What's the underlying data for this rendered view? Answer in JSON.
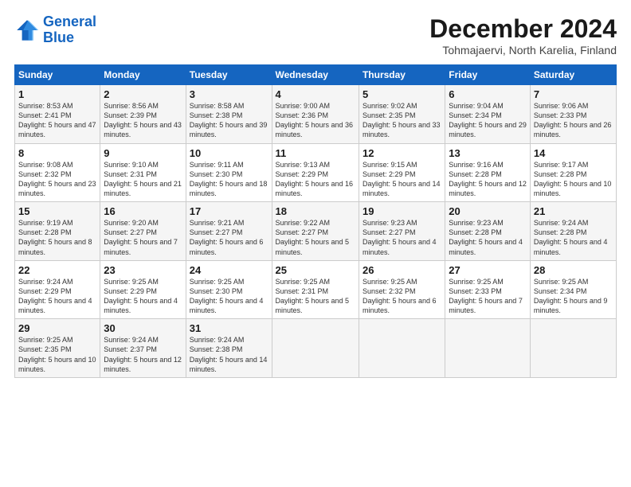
{
  "header": {
    "logo_line1": "General",
    "logo_line2": "Blue",
    "month_title": "December 2024",
    "subtitle": "Tohmajaervi, North Karelia, Finland"
  },
  "columns": [
    "Sunday",
    "Monday",
    "Tuesday",
    "Wednesday",
    "Thursday",
    "Friday",
    "Saturday"
  ],
  "weeks": [
    [
      {
        "day": "1",
        "sunrise": "Sunrise: 8:53 AM",
        "sunset": "Sunset: 2:41 PM",
        "daylight": "Daylight: 5 hours and 47 minutes."
      },
      {
        "day": "2",
        "sunrise": "Sunrise: 8:56 AM",
        "sunset": "Sunset: 2:39 PM",
        "daylight": "Daylight: 5 hours and 43 minutes."
      },
      {
        "day": "3",
        "sunrise": "Sunrise: 8:58 AM",
        "sunset": "Sunset: 2:38 PM",
        "daylight": "Daylight: 5 hours and 39 minutes."
      },
      {
        "day": "4",
        "sunrise": "Sunrise: 9:00 AM",
        "sunset": "Sunset: 2:36 PM",
        "daylight": "Daylight: 5 hours and 36 minutes."
      },
      {
        "day": "5",
        "sunrise": "Sunrise: 9:02 AM",
        "sunset": "Sunset: 2:35 PM",
        "daylight": "Daylight: 5 hours and 33 minutes."
      },
      {
        "day": "6",
        "sunrise": "Sunrise: 9:04 AM",
        "sunset": "Sunset: 2:34 PM",
        "daylight": "Daylight: 5 hours and 29 minutes."
      },
      {
        "day": "7",
        "sunrise": "Sunrise: 9:06 AM",
        "sunset": "Sunset: 2:33 PM",
        "daylight": "Daylight: 5 hours and 26 minutes."
      }
    ],
    [
      {
        "day": "8",
        "sunrise": "Sunrise: 9:08 AM",
        "sunset": "Sunset: 2:32 PM",
        "daylight": "Daylight: 5 hours and 23 minutes."
      },
      {
        "day": "9",
        "sunrise": "Sunrise: 9:10 AM",
        "sunset": "Sunset: 2:31 PM",
        "daylight": "Daylight: 5 hours and 21 minutes."
      },
      {
        "day": "10",
        "sunrise": "Sunrise: 9:11 AM",
        "sunset": "Sunset: 2:30 PM",
        "daylight": "Daylight: 5 hours and 18 minutes."
      },
      {
        "day": "11",
        "sunrise": "Sunrise: 9:13 AM",
        "sunset": "Sunset: 2:29 PM",
        "daylight": "Daylight: 5 hours and 16 minutes."
      },
      {
        "day": "12",
        "sunrise": "Sunrise: 9:15 AM",
        "sunset": "Sunset: 2:29 PM",
        "daylight": "Daylight: 5 hours and 14 minutes."
      },
      {
        "day": "13",
        "sunrise": "Sunrise: 9:16 AM",
        "sunset": "Sunset: 2:28 PM",
        "daylight": "Daylight: 5 hours and 12 minutes."
      },
      {
        "day": "14",
        "sunrise": "Sunrise: 9:17 AM",
        "sunset": "Sunset: 2:28 PM",
        "daylight": "Daylight: 5 hours and 10 minutes."
      }
    ],
    [
      {
        "day": "15",
        "sunrise": "Sunrise: 9:19 AM",
        "sunset": "Sunset: 2:28 PM",
        "daylight": "Daylight: 5 hours and 8 minutes."
      },
      {
        "day": "16",
        "sunrise": "Sunrise: 9:20 AM",
        "sunset": "Sunset: 2:27 PM",
        "daylight": "Daylight: 5 hours and 7 minutes."
      },
      {
        "day": "17",
        "sunrise": "Sunrise: 9:21 AM",
        "sunset": "Sunset: 2:27 PM",
        "daylight": "Daylight: 5 hours and 6 minutes."
      },
      {
        "day": "18",
        "sunrise": "Sunrise: 9:22 AM",
        "sunset": "Sunset: 2:27 PM",
        "daylight": "Daylight: 5 hours and 5 minutes."
      },
      {
        "day": "19",
        "sunrise": "Sunrise: 9:23 AM",
        "sunset": "Sunset: 2:27 PM",
        "daylight": "Daylight: 5 hours and 4 minutes."
      },
      {
        "day": "20",
        "sunrise": "Sunrise: 9:23 AM",
        "sunset": "Sunset: 2:28 PM",
        "daylight": "Daylight: 5 hours and 4 minutes."
      },
      {
        "day": "21",
        "sunrise": "Sunrise: 9:24 AM",
        "sunset": "Sunset: 2:28 PM",
        "daylight": "Daylight: 5 hours and 4 minutes."
      }
    ],
    [
      {
        "day": "22",
        "sunrise": "Sunrise: 9:24 AM",
        "sunset": "Sunset: 2:29 PM",
        "daylight": "Daylight: 5 hours and 4 minutes."
      },
      {
        "day": "23",
        "sunrise": "Sunrise: 9:25 AM",
        "sunset": "Sunset: 2:29 PM",
        "daylight": "Daylight: 5 hours and 4 minutes."
      },
      {
        "day": "24",
        "sunrise": "Sunrise: 9:25 AM",
        "sunset": "Sunset: 2:30 PM",
        "daylight": "Daylight: 5 hours and 4 minutes."
      },
      {
        "day": "25",
        "sunrise": "Sunrise: 9:25 AM",
        "sunset": "Sunset: 2:31 PM",
        "daylight": "Daylight: 5 hours and 5 minutes."
      },
      {
        "day": "26",
        "sunrise": "Sunrise: 9:25 AM",
        "sunset": "Sunset: 2:32 PM",
        "daylight": "Daylight: 5 hours and 6 minutes."
      },
      {
        "day": "27",
        "sunrise": "Sunrise: 9:25 AM",
        "sunset": "Sunset: 2:33 PM",
        "daylight": "Daylight: 5 hours and 7 minutes."
      },
      {
        "day": "28",
        "sunrise": "Sunrise: 9:25 AM",
        "sunset": "Sunset: 2:34 PM",
        "daylight": "Daylight: 5 hours and 9 minutes."
      }
    ],
    [
      {
        "day": "29",
        "sunrise": "Sunrise: 9:25 AM",
        "sunset": "Sunset: 2:35 PM",
        "daylight": "Daylight: 5 hours and 10 minutes."
      },
      {
        "day": "30",
        "sunrise": "Sunrise: 9:24 AM",
        "sunset": "Sunset: 2:37 PM",
        "daylight": "Daylight: 5 hours and 12 minutes."
      },
      {
        "day": "31",
        "sunrise": "Sunrise: 9:24 AM",
        "sunset": "Sunset: 2:38 PM",
        "daylight": "Daylight: 5 hours and 14 minutes."
      },
      null,
      null,
      null,
      null
    ]
  ]
}
